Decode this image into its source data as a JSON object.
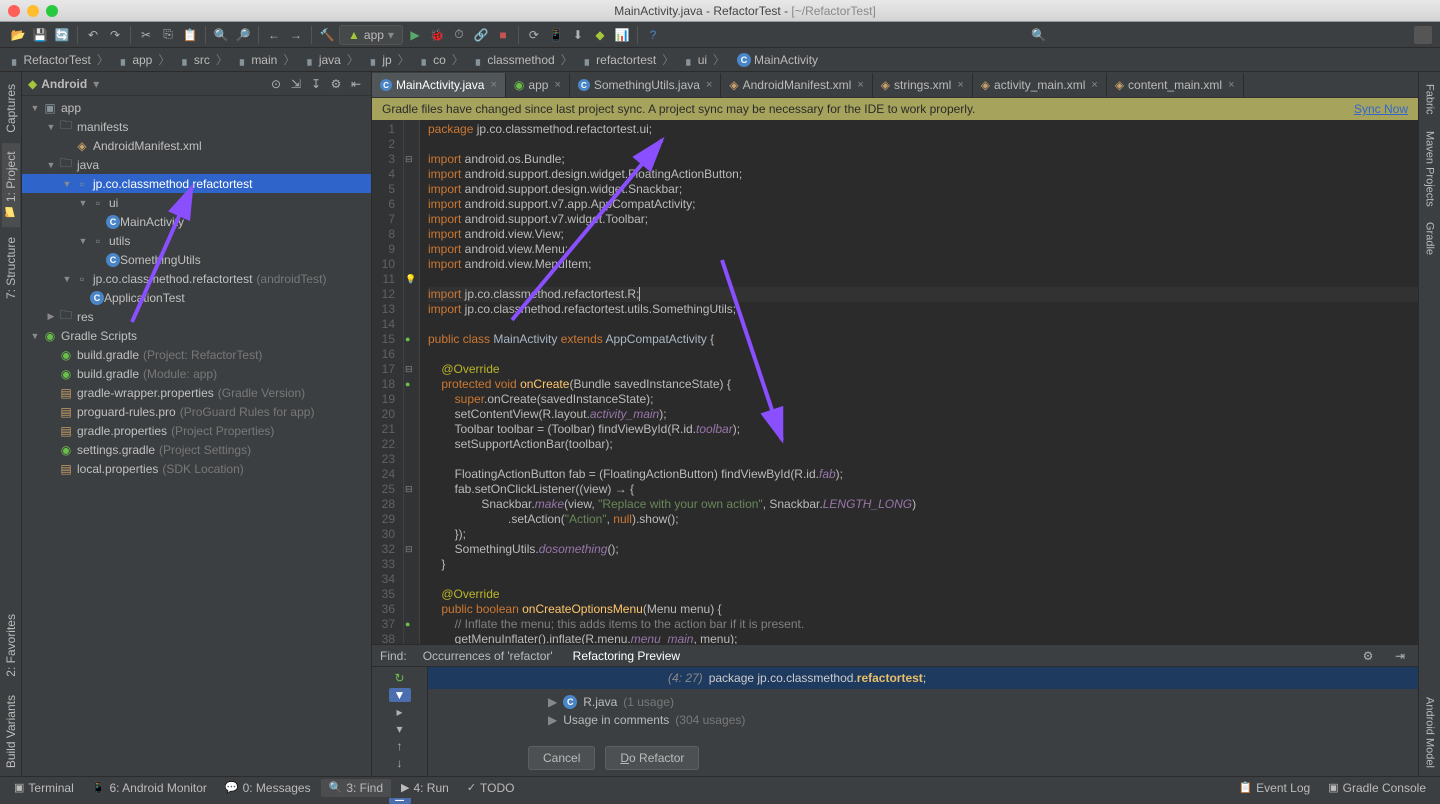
{
  "title": {
    "file": "MainActivity.java",
    "project": "RefactorTest",
    "path": "[~/RefactorTest]"
  },
  "breadcrumbs": [
    "RefactorTest",
    "app",
    "src",
    "main",
    "java",
    "jp",
    "co",
    "classmethod",
    "refactortest",
    "ui",
    "MainActivity"
  ],
  "run_config": "app",
  "project_panel": {
    "title": "Android"
  },
  "tree": [
    {
      "ind": 0,
      "arrow": "▼",
      "ico": "module",
      "label": "app"
    },
    {
      "ind": 1,
      "arrow": "▼",
      "ico": "folder",
      "label": "manifests"
    },
    {
      "ind": 2,
      "arrow": "",
      "ico": "xml",
      "label": "AndroidManifest.xml"
    },
    {
      "ind": 1,
      "arrow": "▼",
      "ico": "folder",
      "label": "java"
    },
    {
      "ind": 2,
      "arrow": "▼",
      "ico": "pkg",
      "label": "jp.co.classmethod.refactortest",
      "sel": true
    },
    {
      "ind": 3,
      "arrow": "▼",
      "ico": "pkg",
      "label": "ui"
    },
    {
      "ind": 4,
      "arrow": "",
      "ico": "class",
      "label": "MainActivity"
    },
    {
      "ind": 3,
      "arrow": "▼",
      "ico": "pkg",
      "label": "utils"
    },
    {
      "ind": 4,
      "arrow": "",
      "ico": "class",
      "label": "SomethingUtils"
    },
    {
      "ind": 2,
      "arrow": "▼",
      "ico": "pkg",
      "label": "jp.co.classmethod.refactortest",
      "hint": "(androidTest)"
    },
    {
      "ind": 3,
      "arrow": "",
      "ico": "class",
      "label": "ApplicationTest"
    },
    {
      "ind": 1,
      "arrow": "▶",
      "ico": "folder",
      "label": "res"
    },
    {
      "ind": 0,
      "arrow": "▼",
      "ico": "gradle",
      "label": "Gradle Scripts"
    },
    {
      "ind": 1,
      "arrow": "",
      "ico": "gradle",
      "label": "build.gradle",
      "hint": "(Project: RefactorTest)"
    },
    {
      "ind": 1,
      "arrow": "",
      "ico": "gradle",
      "label": "build.gradle",
      "hint": "(Module: app)"
    },
    {
      "ind": 1,
      "arrow": "",
      "ico": "prop",
      "label": "gradle-wrapper.properties",
      "hint": "(Gradle Version)"
    },
    {
      "ind": 1,
      "arrow": "",
      "ico": "prop",
      "label": "proguard-rules.pro",
      "hint": "(ProGuard Rules for app)"
    },
    {
      "ind": 1,
      "arrow": "",
      "ico": "prop",
      "label": "gradle.properties",
      "hint": "(Project Properties)"
    },
    {
      "ind": 1,
      "arrow": "",
      "ico": "gradle",
      "label": "settings.gradle",
      "hint": "(Project Settings)"
    },
    {
      "ind": 1,
      "arrow": "",
      "ico": "prop",
      "label": "local.properties",
      "hint": "(SDK Location)"
    }
  ],
  "tabs": [
    {
      "ico": "java",
      "label": "MainActivity.java",
      "active": true
    },
    {
      "ico": "grad",
      "label": "app"
    },
    {
      "ico": "java",
      "label": "SomethingUtils.java"
    },
    {
      "ico": "xml",
      "label": "AndroidManifest.xml"
    },
    {
      "ico": "xml",
      "label": "strings.xml"
    },
    {
      "ico": "xml",
      "label": "activity_main.xml"
    },
    {
      "ico": "xml",
      "label": "content_main.xml"
    }
  ],
  "notice": {
    "msg": "Gradle files have changed since last project sync. A project sync may be necessary for the IDE to work properly.",
    "link": "Sync Now"
  },
  "find_header": {
    "label": "Find:",
    "tab1": "Occurrences of 'refactor'",
    "tab2": "Refactoring Preview"
  },
  "find": {
    "loc": "(4: 27)",
    "text_pre": "package jp.co.classmethod.",
    "text_hi": "refactortest",
    "text_post": ";",
    "row1": {
      "file": "R.java",
      "hint": "(1 usage)"
    },
    "row2": {
      "label": "Usage in comments",
      "hint": "(304 usages)"
    },
    "btn_cancel": "Cancel",
    "btn_do": "Do Refactor"
  },
  "left_tools": {
    "captures": "Captures",
    "project": "1: Project",
    "structure": "7: Structure",
    "favorites": "2: Favorites",
    "bv": "Build Variants"
  },
  "right_tools": {
    "fabric": "Fabric",
    "maven": "Maven Projects",
    "gradle": "Gradle",
    "am": "Android Model"
  },
  "status": {
    "terminal": "Terminal",
    "monitor": "6: Android Monitor",
    "messages": "0: Messages",
    "find": "3: Find",
    "run": "4: Run",
    "todo": "TODO",
    "eventlog": "Event Log",
    "console": "Gradle Console"
  }
}
